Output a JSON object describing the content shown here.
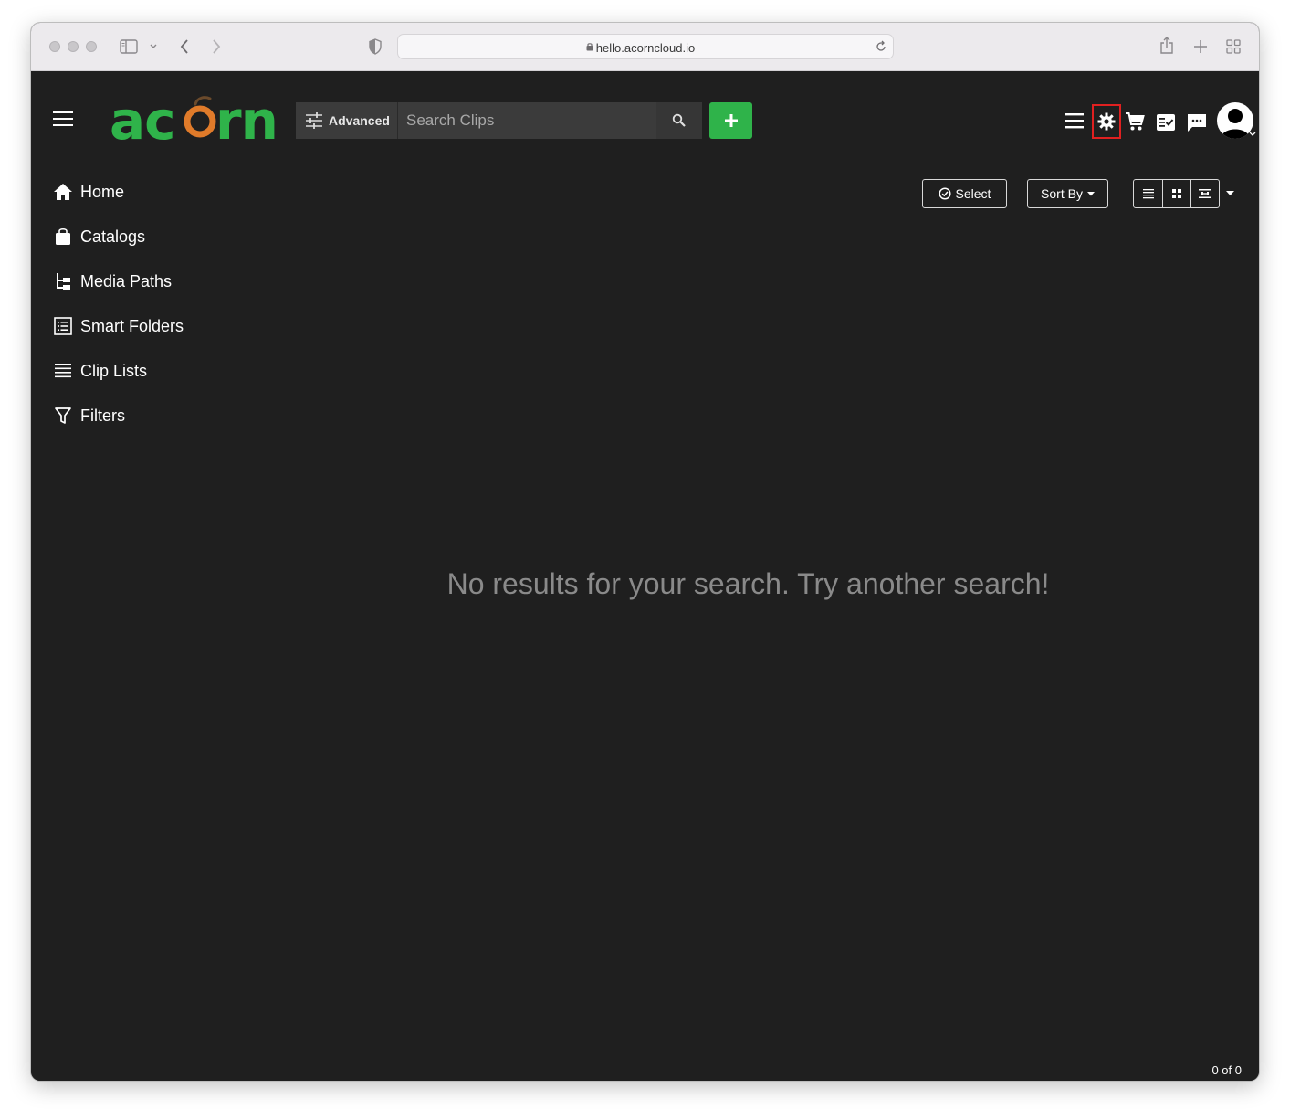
{
  "browser": {
    "url": "hello.acorncloud.io"
  },
  "header": {
    "logo_text": "acorn",
    "advanced_label": "Advanced",
    "search_placeholder": "Search Clips",
    "colors": {
      "add_button": "#2fb34a",
      "logo_green": "#2fb34a",
      "logo_orange": "#e07b2a",
      "highlight": "#e02020"
    },
    "icons": [
      "menu-icon",
      "gear-icon",
      "cart-icon",
      "checklist-icon",
      "chat-icon",
      "avatar-icon"
    ]
  },
  "sidebar": {
    "items": [
      {
        "label": "Home",
        "icon": "home-icon"
      },
      {
        "label": "Catalogs",
        "icon": "shopping-bag-icon"
      },
      {
        "label": "Media Paths",
        "icon": "tree-icon"
      },
      {
        "label": "Smart Folders",
        "icon": "list-box-icon"
      },
      {
        "label": "Clip Lists",
        "icon": "lines-icon"
      },
      {
        "label": "Filters",
        "icon": "filter-icon"
      }
    ]
  },
  "toolbar": {
    "select_label": "Select",
    "sort_label": "Sort By",
    "view_modes": [
      "list-view-icon",
      "grid-view-icon",
      "filmstrip-view-icon"
    ]
  },
  "main": {
    "empty_message": "No results for your search. Try another search!"
  },
  "footer": {
    "count_text": "0 of 0"
  }
}
